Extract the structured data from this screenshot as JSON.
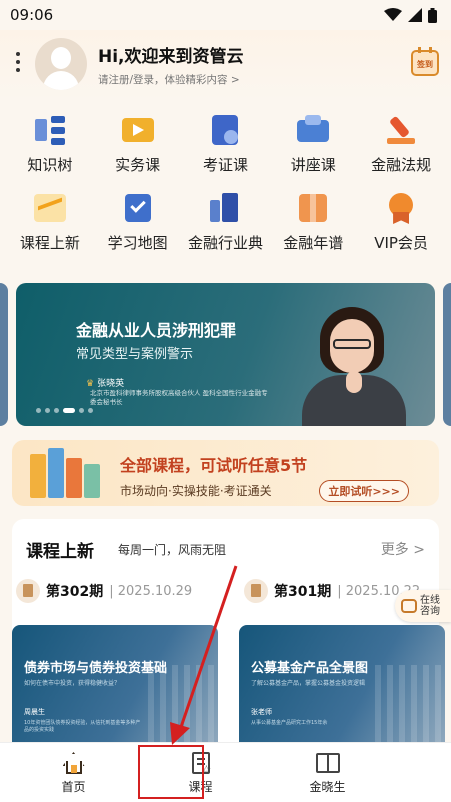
{
  "status_bar": {
    "time": "09:06"
  },
  "header": {
    "greeting": "Hi,欢迎来到资管云",
    "login_prompt": "请注册/登录，体验精彩内容 >",
    "calendar_icon_text": "签到"
  },
  "nav": {
    "row1": [
      {
        "label": "知识树",
        "icon": "knowledge-tree-icon"
      },
      {
        "label": "实务课",
        "icon": "video-course-icon"
      },
      {
        "label": "考证课",
        "icon": "certificate-icon"
      },
      {
        "label": "讲座课",
        "icon": "lecture-icon"
      },
      {
        "label": "金融法规",
        "icon": "gavel-icon"
      }
    ],
    "row2": [
      {
        "label": "课程上新",
        "icon": "trend-chart-icon"
      },
      {
        "label": "学习地图",
        "icon": "clipboard-check-icon"
      },
      {
        "label": "金融行业典",
        "icon": "book-stack-icon"
      },
      {
        "label": "金融年谱",
        "icon": "folded-map-icon"
      },
      {
        "label": "VIP会员",
        "icon": "vip-medal-icon"
      }
    ]
  },
  "banner": {
    "title": "金融从业人员涉刑犯罪",
    "subtitle": "常见类型与案例警示",
    "speaker": "张晓英",
    "speaker_desc": "北京市盈科律师事务所股权高级合伙人 盈科全国性行业金融专委会秘书长"
  },
  "promo": {
    "title": "全部课程，可试听任意5节",
    "subtitle": "市场动向·实操技能·考证通关",
    "button": "立即试听>>>"
  },
  "new_courses": {
    "title": "课程上新",
    "subtitle": "每周一门，风雨无阻",
    "more": "更多 >",
    "issues": [
      {
        "issue": "第302期",
        "date": "2025.10.29"
      },
      {
        "issue": "第301期",
        "date": "2025.10.22"
      }
    ],
    "cards": [
      {
        "title": "债券市场与债券投资基础",
        "caption": "如何在债市中投资，获得稳健收益？",
        "person": "周晨生",
        "note": "10年资管团队债券投资经验，从信托到基金等多种产品的投资实践"
      },
      {
        "title": "公募基金产品全景图",
        "caption": "了解公募基金产品，掌握公募基金投资逻辑",
        "person": "张老师",
        "note": "从事公募基金产品研究工作15年余"
      }
    ]
  },
  "consult": {
    "label_line1": "在线",
    "label_line2": "咨询"
  },
  "tabs": [
    {
      "label": "首页"
    },
    {
      "label": "课程"
    },
    {
      "label": "金晓生"
    }
  ],
  "colors": {
    "accent_orange": "#e89a3c",
    "banner_teal": "#0f5e69",
    "annotation_red": "#d42020"
  }
}
